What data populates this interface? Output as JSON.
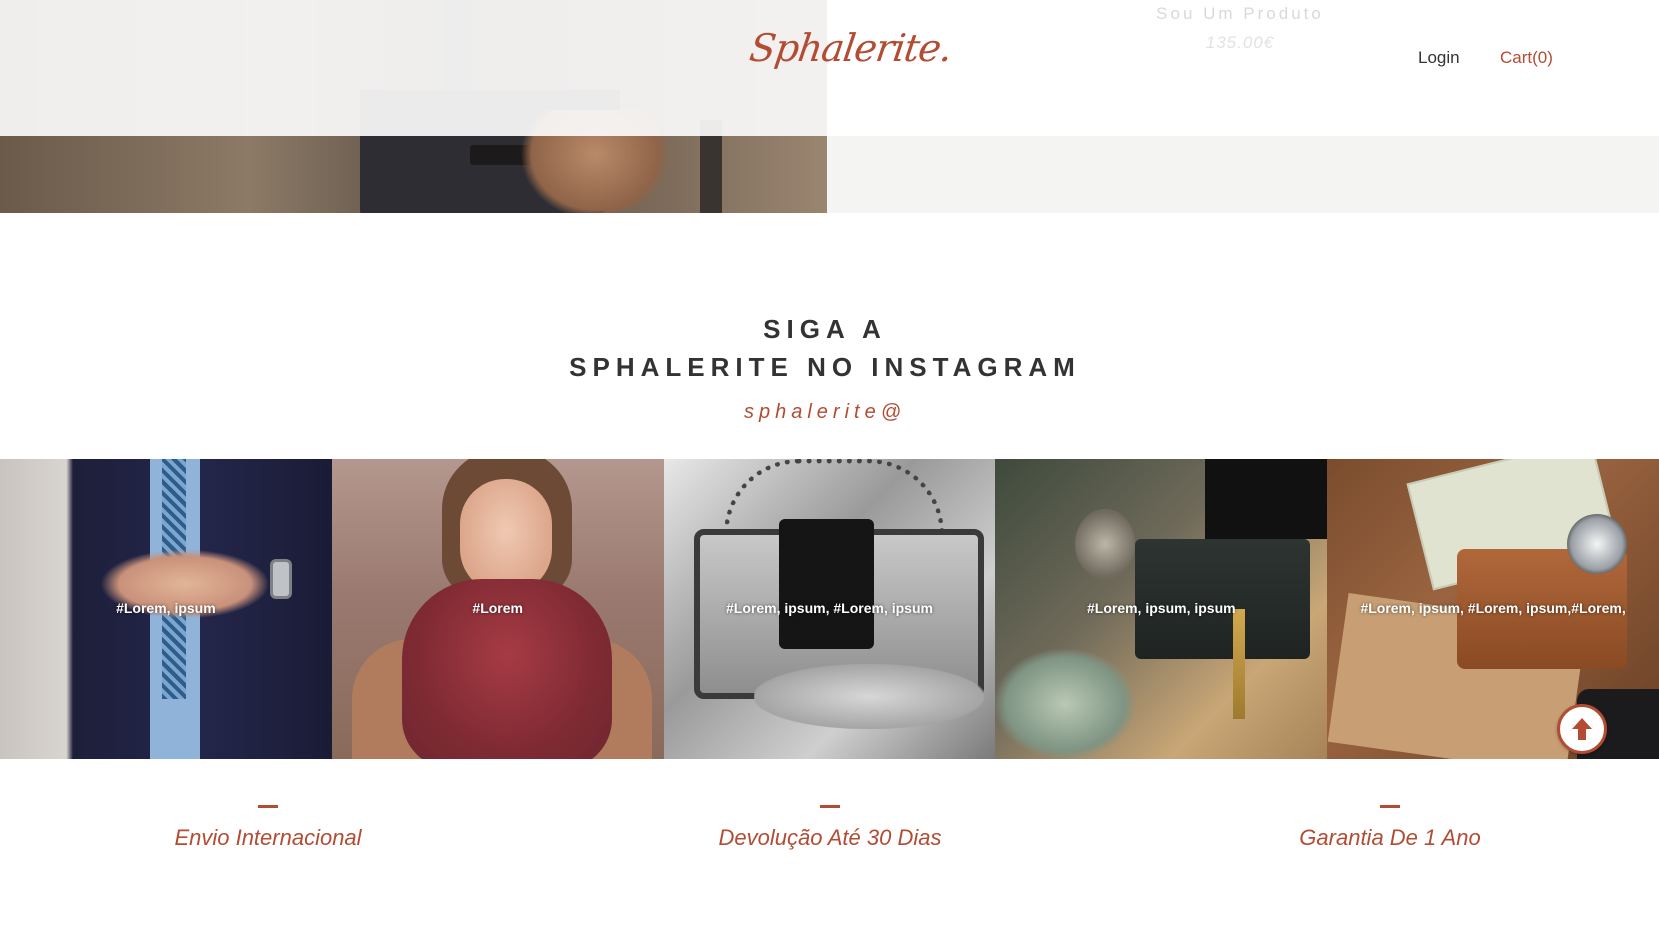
{
  "header": {
    "logo": "Sphalerite.",
    "ghost_product_name": "Sou Um Produto",
    "ghost_product_price": "135.00€",
    "nav": {
      "login": "Login",
      "cart": "Cart(0)"
    }
  },
  "instagram": {
    "title_line1": "SIGA A",
    "title_line2": "SPHALERITE NO INSTAGRAM",
    "handle": "sphalerite@",
    "tiles": [
      {
        "tag": "#Lorem, ipsum"
      },
      {
        "tag": "#Lorem"
      },
      {
        "tag": "#Lorem, ipsum, #Lorem, ipsum"
      },
      {
        "tag": "#Lorem, ipsum, ipsum"
      },
      {
        "tag": "#Lorem, ipsum, #Lorem, ipsum,#Lorem,"
      }
    ]
  },
  "features": [
    {
      "label": "Envio Internacional"
    },
    {
      "label": "Devolução Até 30 Dias"
    },
    {
      "label": "Garantia De 1 Ano"
    }
  ],
  "colors": {
    "accent": "#b24c33",
    "text": "#333333",
    "background": "#ffffff"
  },
  "icons": {
    "scroll_top": "arrow-up-icon"
  }
}
